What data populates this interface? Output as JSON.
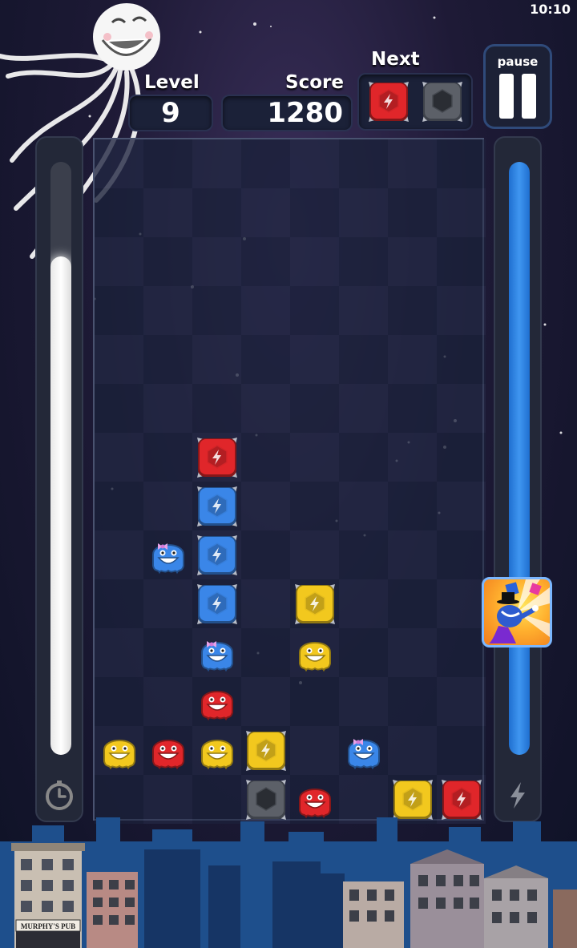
{
  "status_bar": {
    "time": "10:10"
  },
  "header": {
    "level_label": "Level",
    "level_value": "9",
    "score_label": "Score",
    "score_value": "1280",
    "next_label": "Next",
    "next_pieces": [
      "red-gem",
      "gray-stone"
    ]
  },
  "pause_button": {
    "label": "pause"
  },
  "meters": {
    "left": {
      "icon": "timer-icon",
      "fill_fraction": 0.84,
      "color": "#ffffff"
    },
    "right": {
      "icon": "lightning-icon",
      "fill_fraction": 1.0,
      "color": "#3f96f0"
    }
  },
  "board": {
    "columns": 8,
    "rows": 14,
    "pieces": [
      {
        "row": 6,
        "col": 2,
        "type": "red-gem"
      },
      {
        "row": 7,
        "col": 2,
        "type": "blue-gem"
      },
      {
        "row": 8,
        "col": 1,
        "type": "blue-blob"
      },
      {
        "row": 8,
        "col": 2,
        "type": "blue-gem"
      },
      {
        "row": 9,
        "col": 2,
        "type": "blue-gem"
      },
      {
        "row": 9,
        "col": 4,
        "type": "yellow-gem"
      },
      {
        "row": 10,
        "col": 2,
        "type": "blue-blob"
      },
      {
        "row": 10,
        "col": 4,
        "type": "yellow-blob"
      },
      {
        "row": 11,
        "col": 2,
        "type": "red-blob"
      },
      {
        "row": 12,
        "col": 0,
        "type": "yellow-blob"
      },
      {
        "row": 12,
        "col": 1,
        "type": "red-blob"
      },
      {
        "row": 12,
        "col": 2,
        "type": "yellow-blob"
      },
      {
        "row": 12,
        "col": 3,
        "type": "yellow-gem"
      },
      {
        "row": 12,
        "col": 5,
        "type": "blue-blob"
      },
      {
        "row": 13,
        "col": 3,
        "type": "gray-stone"
      },
      {
        "row": 13,
        "col": 4,
        "type": "red-blob"
      },
      {
        "row": 13,
        "col": 6,
        "type": "yellow-gem"
      },
      {
        "row": 13,
        "col": 7,
        "type": "red-gem"
      }
    ]
  },
  "powerup": {
    "icon": "magician-powerup-icon"
  },
  "background": {
    "sign_text": "MURPHY'S PUB"
  },
  "colors": {
    "red": "#e0262a",
    "blue": "#3a86e8",
    "yellow": "#f2c81e",
    "gray": "#5c6068"
  }
}
